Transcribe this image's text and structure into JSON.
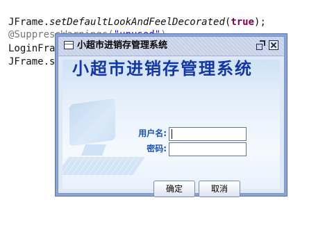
{
  "editor": {
    "lines": [
      {
        "parts": [
          "JFrame.",
          "setDefaultLookAndFeelDecorated",
          "(",
          "true",
          ");"
        ]
      },
      {
        "annotation": "@Suppress",
        "hidden_mid": "Warnings(",
        "string": "\"unused\"",
        "close": ")"
      },
      {
        "visible": "LoginFra"
      },
      {
        "visible": "JFrame.s"
      }
    ]
  },
  "dialog": {
    "title": "小超市进销存管理系统",
    "heading": "小超市进销存管理系统",
    "username_label": "用户名:",
    "username_value": "",
    "password_label": "密码:",
    "password_value": "",
    "ok_label": "确定",
    "cancel_label": "取消",
    "icons": {
      "window": "window-icon",
      "restore": "restore-icon",
      "close": "close-icon"
    }
  },
  "colors": {
    "heading": "#1236a8",
    "label": "#1a55b8",
    "frame_border": "#8aa4d6",
    "keyword": "#7f0055",
    "string": "#2a00ff",
    "annotation": "#777777"
  }
}
